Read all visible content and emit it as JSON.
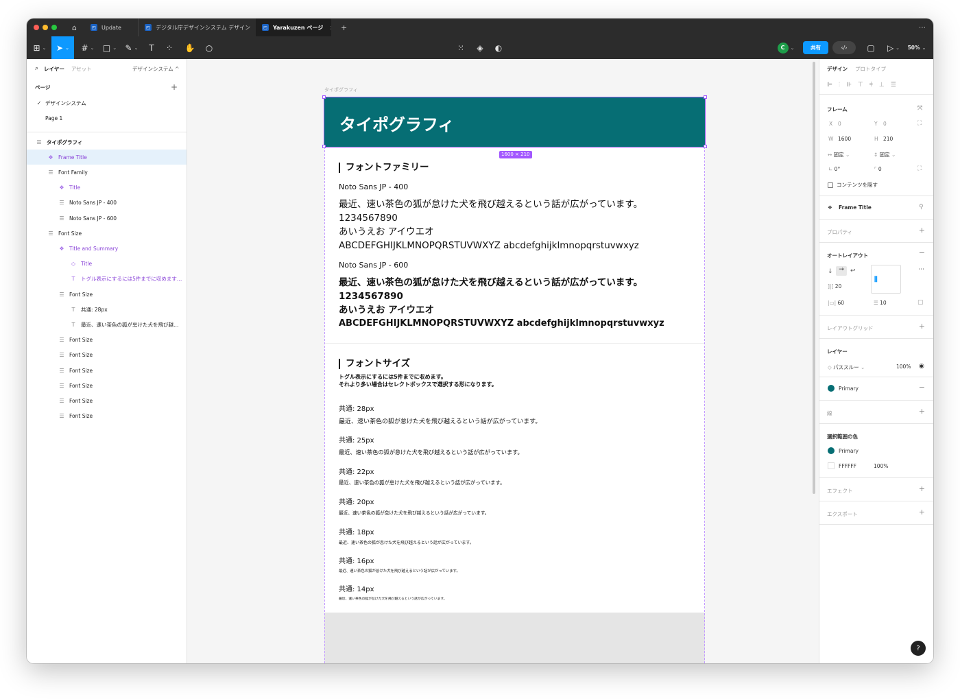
{
  "tabs": [
    {
      "label": "Update"
    },
    {
      "label": "デジタル庁デザインシステム デザイン"
    },
    {
      "label": "Yarakuzen ページ"
    }
  ],
  "toolbar": {
    "share_label": "共有",
    "zoom_label": "50%",
    "user_initial": "C"
  },
  "left": {
    "tab_layers": "レイヤー",
    "tab_assets": "アセット",
    "page_dropdown": "デザインシステム ^",
    "pages_header": "ページ",
    "pages": [
      {
        "label": "デザインシステム",
        "check": "✓"
      },
      {
        "label": "Page 1"
      }
    ],
    "layers": [
      {
        "label": "タイポグラフィ",
        "icon": "☰"
      },
      {
        "label": "Frame Title",
        "icon": "❖"
      },
      {
        "label": "Font Family",
        "icon": "☰"
      },
      {
        "label": "Title",
        "icon": "❖"
      },
      {
        "label": "Noto Sans JP - 400",
        "icon": "☰"
      },
      {
        "label": "Noto Sans JP - 600",
        "icon": "☰"
      },
      {
        "label": "Font Size",
        "icon": "☰"
      },
      {
        "label": "Title and Summary",
        "icon": "❖"
      },
      {
        "label": "Title",
        "icon": "◇"
      },
      {
        "label": "トグル表示にするには5件までに収めます…",
        "icon": "T"
      },
      {
        "label": "Font Size",
        "icon": "☰"
      },
      {
        "label": "共通: 28px",
        "icon": "T"
      },
      {
        "label": "最近、速い茶色の狐が怠けた犬を飛び越…",
        "icon": "T"
      },
      {
        "label": "Font Size",
        "icon": "☰"
      },
      {
        "label": "Font Size",
        "icon": "☰"
      },
      {
        "label": "Font Size",
        "icon": "☰"
      },
      {
        "label": "Font Size",
        "icon": "☰"
      },
      {
        "label": "Font Size",
        "icon": "☰"
      },
      {
        "label": "Font Size",
        "icon": "☰"
      }
    ]
  },
  "canvas": {
    "frame_label": "タイポグラフィ",
    "header_title": "タイポグラフィ",
    "size_badge": "1600 × 210",
    "family_heading": "フォントファミリー",
    "font400_label": "Noto Sans JP - 400",
    "font600_label": "Noto Sans JP - 600",
    "sample_lines": [
      "最近、速い茶色の狐が怠けた犬を飛び越えるという話が広がっています。",
      "1234567890",
      "あいうえお アイウエオ",
      "ABCDEFGHIJKLMNOPQRSTUVWXYZ abcdefghijklmnopqrstuvwxyz"
    ],
    "size_heading": "フォントサイズ",
    "size_summary": [
      "トグル表示にするには5件までに収めます。",
      "それより多い場合はセレクトボックスで選択する形になります。"
    ],
    "size_sample": "最近、速い茶色の狐が怠けた犬を飛び越えるという話が広がっています。",
    "sizes": [
      {
        "label": "共通: 28px"
      },
      {
        "label": "共通: 25px"
      },
      {
        "label": "共通: 22px"
      },
      {
        "label": "共通: 20px"
      },
      {
        "label": "共通: 18px"
      },
      {
        "label": "共通: 16px"
      },
      {
        "label": "共通: 14px"
      }
    ]
  },
  "right": {
    "tab_design": "デザイン",
    "tab_prototype": "プロトタイプ",
    "frame_label": "フレーム",
    "x_label": "X",
    "x_value": "0",
    "y_label": "Y",
    "y_value": "0",
    "w_label": "W",
    "w_value": "1600",
    "h_label": "H",
    "h_value": "210",
    "fixed_w": "固定",
    "fixed_h": "固定",
    "rotation": "0°",
    "radius": "0",
    "clip_label": "コンテンツを隠す",
    "component_name": "Frame Title",
    "properties": "プロパティ",
    "auto_layout": "オートレイアウト",
    "gap_value": "20",
    "padding_h": "60",
    "padding_v": "10",
    "layout_grid": "レイアウトグリッド",
    "layer_label": "レイヤー",
    "blend": "パススルー",
    "opacity": "100%",
    "fill_name": "Primary",
    "stroke_label": "線",
    "selection_colors": "選択範囲の色",
    "sel_color1": "Primary",
    "sel_color2_hex": "FFFFFF",
    "sel_color2_opacity": "100%",
    "effects": "エフェクト",
    "export": "エクスポート",
    "help": "?"
  },
  "colors": {
    "primary": "#066E74",
    "accent": "#0D99FF",
    "selection": "#A257FF"
  }
}
